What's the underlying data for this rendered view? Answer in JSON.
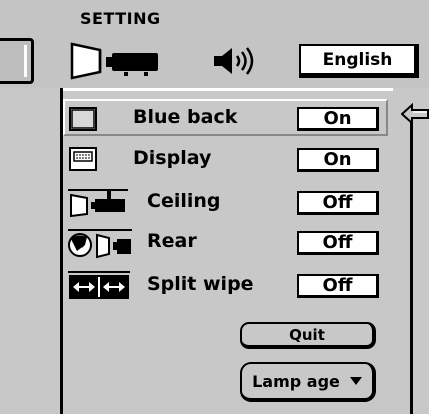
{
  "header": {
    "title": "SETTING",
    "language": "English"
  },
  "menu": {
    "items": [
      {
        "label": "Blue back",
        "value": "On",
        "icon": "blue-back-icon"
      },
      {
        "label": "Display",
        "value": "On",
        "icon": "display-icon"
      },
      {
        "label": "Ceiling",
        "value": "Off",
        "icon": "ceiling-icon"
      },
      {
        "label": "Rear",
        "value": "Off",
        "icon": "rear-icon"
      },
      {
        "label": "Split wipe",
        "value": "Off",
        "icon": "split-wipe-icon"
      }
    ],
    "quit_label": "Quit",
    "lamp_age_label": "Lamp age"
  },
  "colors": {
    "background": "#c8c8c8",
    "box": "#ffffff",
    "text": "#000000"
  }
}
